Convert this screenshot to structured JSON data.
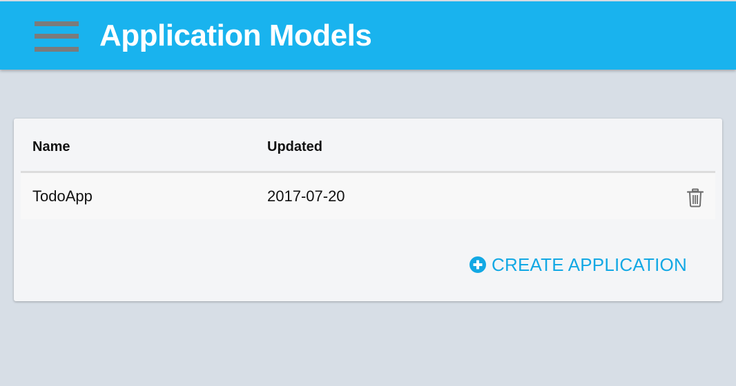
{
  "header": {
    "title": "Application Models",
    "menu_icon": "hamburger-menu-icon",
    "background_color": "#19b3ee"
  },
  "table": {
    "columns": [
      "Name",
      "Updated"
    ],
    "rows": [
      {
        "name": "TodoApp",
        "updated": "2017-07-20",
        "action_icon": "trash-icon"
      }
    ]
  },
  "actions": {
    "create_label": "CREATE APPLICATION",
    "create_icon": "plus-circle-icon",
    "accent_color": "#12a8e4"
  }
}
